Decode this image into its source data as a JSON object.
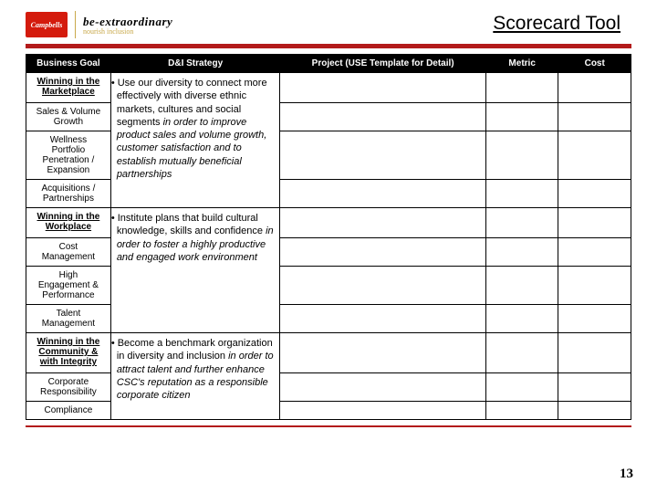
{
  "logo": {
    "brand": "Campbells",
    "tag_top": "be-extraordinary",
    "tag_sub": "nourish inclusion"
  },
  "title": "Scorecard Tool",
  "headers": {
    "goal": "Business Goal",
    "strategy": "D&I Strategy",
    "project": "Project (USE Template for Detail)",
    "metric": "Metric",
    "cost": "Cost"
  },
  "sections": [
    {
      "head": "Winning in the Marketplace",
      "subs": [
        "Sales & Volume Growth",
        "Wellness Portfolio Penetration / Expansion",
        "Acquisitions / Partnerships"
      ],
      "strategy_pre": "• Use our diversity to connect more effectively with diverse ethnic markets, cultures and social segments ",
      "strategy_italic": "in order to improve product sales and volume growth, customer satisfaction and to establish mutually beneficial partnerships"
    },
    {
      "head": "Winning in the Workplace",
      "subs": [
        "Cost Management",
        "High Engagement & Performance",
        "Talent Management"
      ],
      "strategy_pre": "• Institute plans that build cultural knowledge, skills and confidence ",
      "strategy_italic": "in order to foster a highly productive and engaged work environment"
    },
    {
      "head": "Winning in the Community & with Integrity",
      "subs": [
        "Corporate Responsibility",
        "Compliance"
      ],
      "strategy_pre": "• Become a benchmark organization in diversity and inclusion ",
      "strategy_italic": "in order to attract talent and further enhance CSC's reputation as a responsible corporate citizen"
    }
  ],
  "page": "13"
}
